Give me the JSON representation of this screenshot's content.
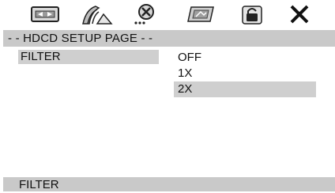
{
  "icons": [
    {
      "name": "general-setup-icon"
    },
    {
      "name": "audio-setup-icon"
    },
    {
      "name": "dolby-setup-icon"
    },
    {
      "name": "preference-setup-icon"
    },
    {
      "name": "password-lock-icon"
    },
    {
      "name": "exit-icon"
    }
  ],
  "header": {
    "title": "- - HDCD SETUP PAGE - -"
  },
  "menu": {
    "selected_item": "FILTER"
  },
  "options": {
    "items": [
      "OFF",
      "1X",
      "2X"
    ],
    "highlighted": "2X"
  },
  "footer": {
    "status": "FILTER"
  },
  "colors": {
    "highlight": "#cfcfcf",
    "header": "#c9c9c9",
    "text": "#111111"
  }
}
